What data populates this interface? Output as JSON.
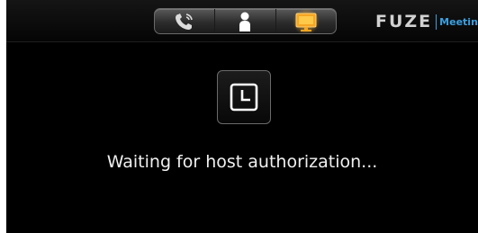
{
  "toolbar": {
    "tabs": [
      {
        "icon": "phone-icon",
        "active": false
      },
      {
        "icon": "person-icon",
        "active": false
      },
      {
        "icon": "screen-share-icon",
        "active": true
      }
    ],
    "active_color": "#f5a623"
  },
  "brand": {
    "logo": "FUZE",
    "product": "Meeting",
    "accent_color": "#3b9fe0"
  },
  "main": {
    "status_icon": "clock-icon",
    "status_text": "Waiting for host authorization..."
  }
}
